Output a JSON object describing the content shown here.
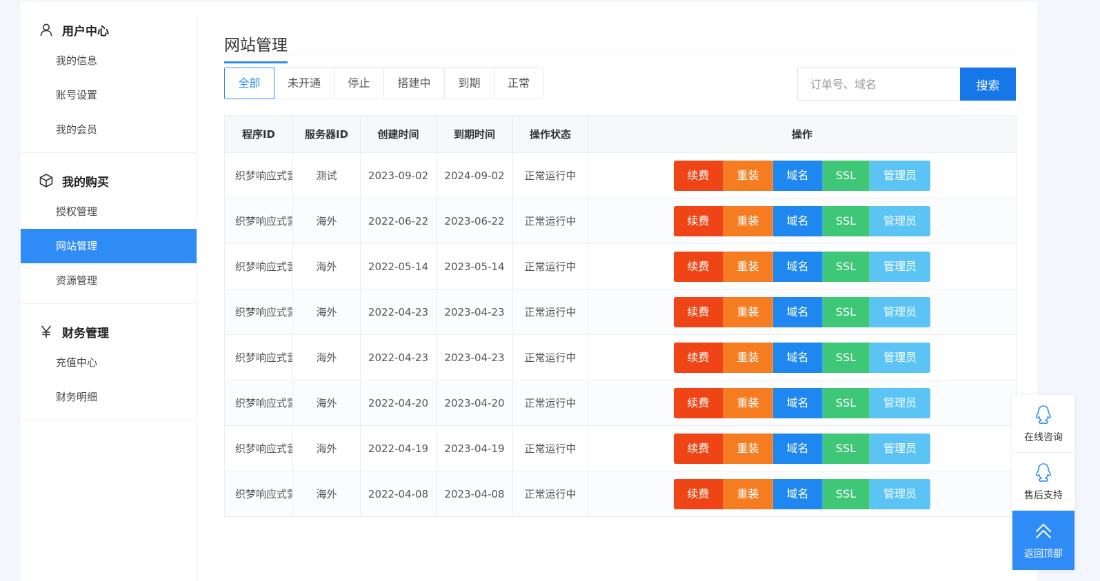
{
  "sidebar": {
    "groups": [
      {
        "title": "用户中心",
        "icon": "user-icon",
        "items": [
          {
            "label": "我的信息"
          },
          {
            "label": "账号设置"
          },
          {
            "label": "我的会员"
          }
        ]
      },
      {
        "title": "我的购买",
        "icon": "box-icon",
        "items": [
          {
            "label": "授权管理"
          },
          {
            "label": "网站管理",
            "active": true
          },
          {
            "label": "资源管理"
          }
        ]
      },
      {
        "title": "财务管理",
        "icon": "yen-icon",
        "items": [
          {
            "label": "充值中心"
          },
          {
            "label": "财务明细"
          }
        ]
      }
    ]
  },
  "main": {
    "title": "网站管理",
    "filters": [
      "全部",
      "未开通",
      "停止",
      "搭建中",
      "到期",
      "正常"
    ],
    "active_filter": "全部",
    "search": {
      "placeholder": "订单号、域名",
      "value": "",
      "button": "搜索"
    },
    "table": {
      "headers": [
        "程序ID",
        "服务器ID",
        "创建时间",
        "到期时间",
        "操作状态",
        "操作"
      ],
      "actions": [
        {
          "label": "续费",
          "color": "#ef4415"
        },
        {
          "label": "重装",
          "color": "#f57c20"
        },
        {
          "label": "域名",
          "color": "#1e88f0"
        },
        {
          "label": "SSL",
          "color": "#3fc778"
        },
        {
          "label": "管理员",
          "color": "#5bc4f5"
        }
      ],
      "rows": [
        {
          "program": "织梦响应式营",
          "server": "测试",
          "created": "2023-09-02",
          "expires": "2024-09-02",
          "status": "正常运行中"
        },
        {
          "program": "织梦响应式营",
          "server": "海外",
          "created": "2022-06-22",
          "expires": "2023-06-22",
          "status": "正常运行中"
        },
        {
          "program": "织梦响应式营",
          "server": "海外",
          "created": "2022-05-14",
          "expires": "2023-05-14",
          "status": "正常运行中"
        },
        {
          "program": "织梦响应式营",
          "server": "海外",
          "created": "2022-04-23",
          "expires": "2023-04-23",
          "status": "正常运行中"
        },
        {
          "program": "织梦响应式营",
          "server": "海外",
          "created": "2022-04-23",
          "expires": "2023-04-23",
          "status": "正常运行中"
        },
        {
          "program": "织梦响应式营",
          "server": "海外",
          "created": "2022-04-20",
          "expires": "2023-04-20",
          "status": "正常运行中"
        },
        {
          "program": "织梦响应式营",
          "server": "海外",
          "created": "2022-04-19",
          "expires": "2023-04-19",
          "status": "正常运行中"
        },
        {
          "program": "织梦响应式营",
          "server": "海外",
          "created": "2022-04-08",
          "expires": "2023-04-08",
          "status": "正常运行中"
        }
      ]
    }
  },
  "float_bar": {
    "consult": {
      "label": "在线咨询",
      "icon": "qq-icon"
    },
    "support": {
      "label": "售后支持",
      "icon": "qq-icon"
    },
    "top": {
      "label": "返回顶部",
      "icon": "chevron-double-up-icon"
    }
  }
}
